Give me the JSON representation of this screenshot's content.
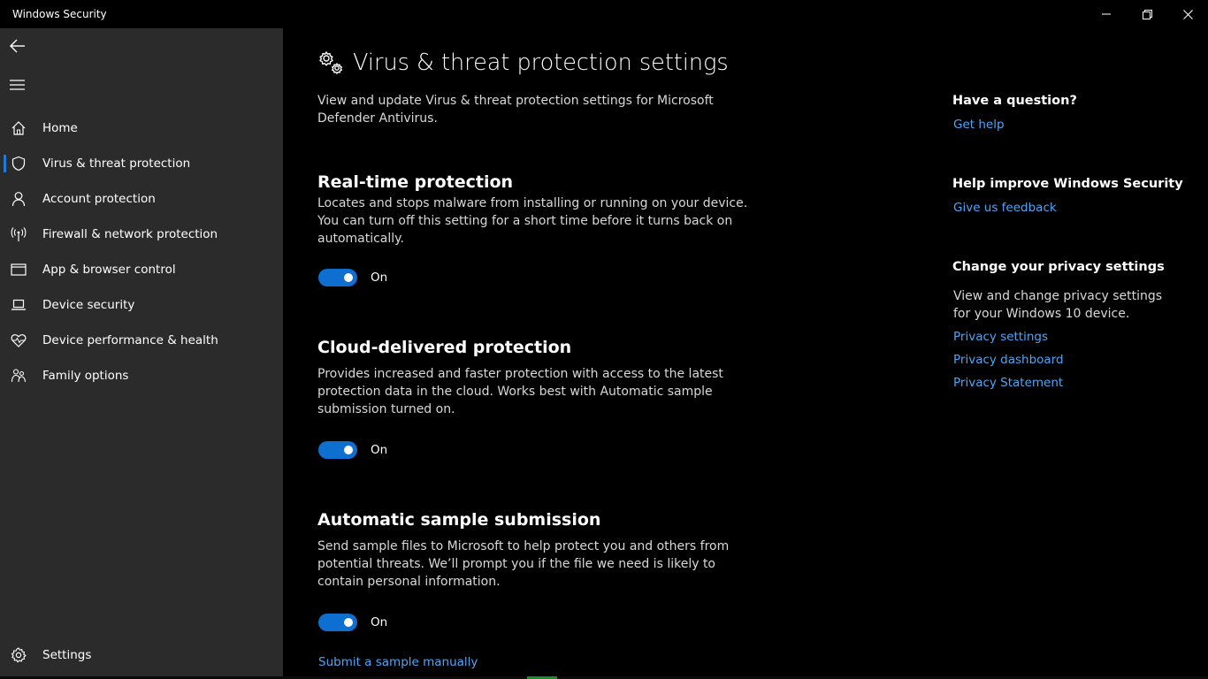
{
  "window": {
    "title": "Windows Security",
    "controls": {
      "minimize": "—",
      "maximize": "❐",
      "close": "✕"
    }
  },
  "sidebar": {
    "items": [
      {
        "label": "Home",
        "icon": "home-icon"
      },
      {
        "label": "Virus & threat protection",
        "icon": "shield-icon",
        "active": true
      },
      {
        "label": "Account protection",
        "icon": "person-icon"
      },
      {
        "label": "Firewall & network protection",
        "icon": "antenna-icon"
      },
      {
        "label": "App & browser control",
        "icon": "browser-window-icon"
      },
      {
        "label": "Device security",
        "icon": "laptop-icon"
      },
      {
        "label": "Device performance & health",
        "icon": "heart-pulse-icon"
      },
      {
        "label": "Family options",
        "icon": "family-icon"
      }
    ],
    "settings_label": "Settings"
  },
  "main": {
    "title": "Virus & threat protection settings",
    "description": "View and update Virus & threat protection settings for Microsoft Defender Antivirus.",
    "sections": [
      {
        "title": "Real-time protection",
        "description": "Locates and stops malware from installing or running on your device. You can turn off this setting for a short time before it turns back on automatically.",
        "toggle_state": "On"
      },
      {
        "title": "Cloud-delivered protection",
        "description": "Provides increased and faster protection with access to the latest protection data in the cloud. Works best with Automatic sample submission turned on.",
        "toggle_state": "On"
      },
      {
        "title": "Automatic sample submission",
        "description": "Send sample files to Microsoft to help protect you and others from potential threats. We’ll prompt you if the file we need is likely to contain personal information.",
        "toggle_state": "On"
      }
    ],
    "submit_link": "Submit a sample manually"
  },
  "right_panel": {
    "question_heading": "Have a question?",
    "get_help": "Get help",
    "improve_heading": "Help improve Windows Security",
    "feedback": "Give us feedback",
    "privacy_heading": "Change your privacy settings",
    "privacy_text": "View and change privacy settings for your Windows 10 device.",
    "privacy_links": [
      "Privacy settings",
      "Privacy dashboard",
      "Privacy Statement"
    ]
  },
  "colors": {
    "sidebar_bg": "#2b2b2b",
    "main_bg": "#000000",
    "accent": "#0f6fd0",
    "link": "#4ea5f5"
  }
}
